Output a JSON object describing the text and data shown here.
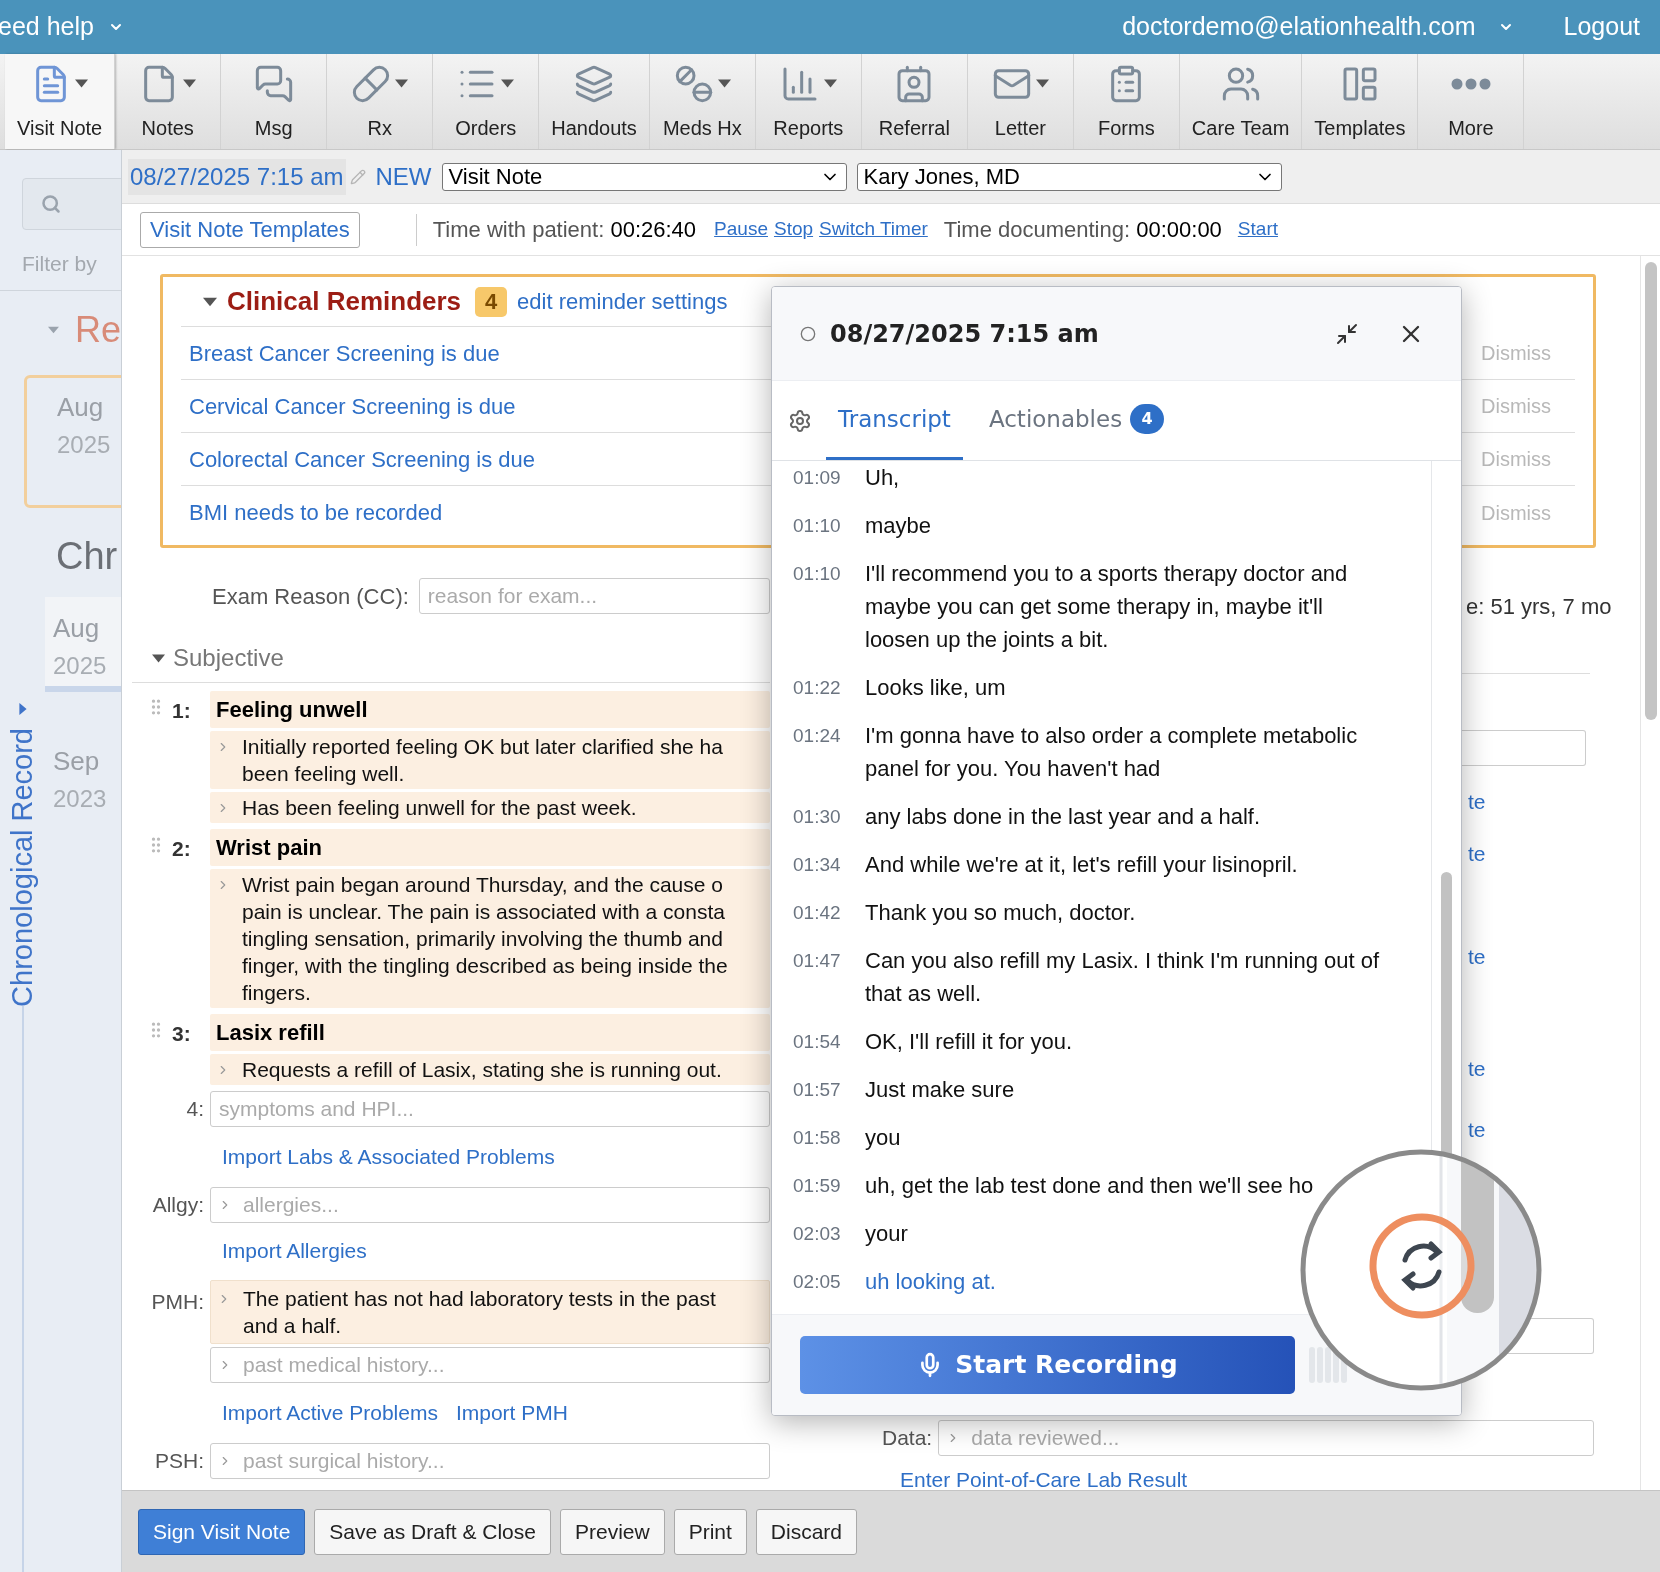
{
  "top_bar": {
    "help_menu": "eed help",
    "user_email": "doctordemo@elationhealth.com",
    "logout": "Logout"
  },
  "toolbar": [
    {
      "label": "Visit Note",
      "selected": true,
      "has_menu": true
    },
    {
      "label": "Notes",
      "selected": false,
      "has_menu": true
    },
    {
      "label": "Msg",
      "selected": false,
      "has_menu": false
    },
    {
      "label": "Rx",
      "selected": false,
      "has_menu": true
    },
    {
      "label": "Orders",
      "selected": false,
      "has_menu": true
    },
    {
      "label": "Handouts",
      "selected": false,
      "has_menu": false
    },
    {
      "label": "Meds Hx",
      "selected": false,
      "has_menu": true
    },
    {
      "label": "Reports",
      "selected": false,
      "has_menu": true
    },
    {
      "label": "Referral",
      "selected": false,
      "has_menu": false
    },
    {
      "label": "Letter",
      "selected": false,
      "has_menu": true
    },
    {
      "label": "Forms",
      "selected": false,
      "has_menu": false
    },
    {
      "label": "Care Team",
      "selected": false,
      "has_menu": false
    },
    {
      "label": "Templates",
      "selected": false,
      "has_menu": false
    },
    {
      "label": "More",
      "selected": false,
      "has_menu": false
    }
  ],
  "sidebar": {
    "filter_label": "Filter by",
    "section_title": "Re",
    "reminder_card": {
      "month": "Aug",
      "year": "2025"
    },
    "record_heading": "Chr",
    "entries": [
      {
        "month": "Aug",
        "year": "2025",
        "selected": true
      },
      {
        "month": "Sep",
        "year": "2023",
        "selected": false
      }
    ],
    "vertical_label": "Chronological Record"
  },
  "note_header": {
    "date": "08/27/2025 7:15 am",
    "status": "NEW",
    "note_type": "Visit Note",
    "provider": "Kary Jones, MD"
  },
  "timer": {
    "templates_button": "Visit Note Templates",
    "patient_label": "Time with patient:",
    "patient_time": "00:26:40",
    "patient_actions": [
      "Pause",
      "Stop",
      "Switch Timer"
    ],
    "doc_label": "Time documenting:",
    "doc_time": "00:00:00",
    "doc_action": "Start"
  },
  "reminders": {
    "title": "Clinical Reminders",
    "count": "4",
    "settings_link": "edit reminder settings",
    "expanded": true,
    "items": [
      {
        "text": "Breast Cancer Screening is due",
        "action": "Dismiss"
      },
      {
        "text": "Cervical Cancer Screening is due",
        "action": "Dismiss"
      },
      {
        "text": "Colorectal Cancer Screening is due",
        "action": "Dismiss"
      },
      {
        "text": "BMI needs to be recorded",
        "action": "Dismiss"
      }
    ]
  },
  "exam_reason": {
    "label": "Exam Reason (CC):",
    "placeholder": "reason for exam..."
  },
  "subjective": {
    "title": "Subjective",
    "expanded": true,
    "problems": [
      {
        "number": "1:",
        "title": "Feeling unwell",
        "notes": [
          {
            "lines": [
              "Initially reported feeling OK but later clarified she ha",
              "been feeling well."
            ]
          },
          {
            "lines": [
              "Has been feeling unwell for the past week."
            ]
          }
        ]
      },
      {
        "number": "2:",
        "title": "Wrist pain",
        "notes": [
          {
            "lines": [
              "Wrist pain began around Thursday, and the cause o",
              "pain is unclear. The pain is associated with a consta",
              "tingling sensation, primarily involving the thumb and",
              "finger, with the tingling described as being inside the",
              "fingers."
            ]
          }
        ]
      },
      {
        "number": "3:",
        "title": "Lasix refill",
        "notes": [
          {
            "lines": [
              "Requests a refill of Lasix, stating she is running out."
            ]
          }
        ]
      }
    ],
    "new_problem": {
      "number": "4:",
      "placeholder": "symptoms and HPI..."
    },
    "import_link": "Import Labs & Associated Problems"
  },
  "allergies": {
    "label": "Allgy:",
    "placeholder": "allergies...",
    "link": "Import Allergies"
  },
  "pmh": {
    "label": "PMH:",
    "entries": [
      {
        "lines": [
          "The patient has not had laboratory tests in the past",
          "and a half."
        ]
      }
    ],
    "placeholder": "past medical history...",
    "links": [
      "Import Active Problems",
      "Import PMH"
    ]
  },
  "psh": {
    "label": "PSH:",
    "placeholder": "past surgical history..."
  },
  "right_column": {
    "age_fragment": "e: 51 yrs, 7 mo",
    "link_fragments": [
      "te",
      "te",
      "te",
      "te",
      "te"
    ],
    "data_label": "Data:",
    "data_placeholder": "data reviewed...",
    "poc_link": "Enter Point-of-Care Lab Result"
  },
  "footer_buttons": [
    {
      "label": "Sign Visit Note",
      "kind": "primary"
    },
    {
      "label": "Save as Draft & Close",
      "kind": "secondary"
    },
    {
      "label": "Preview",
      "kind": "secondary"
    },
    {
      "label": "Print",
      "kind": "secondary"
    },
    {
      "label": "Discard",
      "kind": "secondary"
    }
  ],
  "transcript_panel": {
    "date": "08/27/2025 7:15 am",
    "tabs": [
      {
        "label": "Transcript",
        "selected": true
      },
      {
        "label": "Actionables",
        "selected": false,
        "badge": "4"
      }
    ],
    "entries": [
      {
        "time": "01:09",
        "text": "Uh,",
        "highlighted": false
      },
      {
        "time": "01:10",
        "text": "maybe",
        "highlighted": false
      },
      {
        "time": "01:10",
        "text": "I'll recommend you to a sports therapy doctor and maybe you can get some therapy in, maybe it'll loosen up the joints a bit.",
        "highlighted": false
      },
      {
        "time": "01:22",
        "text": "Looks like, um",
        "highlighted": false
      },
      {
        "time": "01:24",
        "text": "I'm gonna have to also order a complete metabolic panel for you. You haven't had",
        "highlighted": false
      },
      {
        "time": "01:30",
        "text": "any labs done in the last year and a half.",
        "highlighted": false
      },
      {
        "time": "01:34",
        "text": "And while we're at it, let's refill your lisinopril.",
        "highlighted": false
      },
      {
        "time": "01:42",
        "text": "Thank you so much, doctor.",
        "highlighted": false
      },
      {
        "time": "01:47",
        "text": "Can you also refill my Lasix. I think I'm running out of that as well.",
        "highlighted": false
      },
      {
        "time": "01:54",
        "text": "OK, I'll refill it for you.",
        "highlighted": false
      },
      {
        "time": "01:57",
        "text": "Just make sure",
        "highlighted": false
      },
      {
        "time": "01:58",
        "text": "you",
        "highlighted": false
      },
      {
        "time": "01:59",
        "text": "uh, get the lab test done and then we'll see ho",
        "highlighted": false
      },
      {
        "time": "02:03",
        "text": "your",
        "highlighted": false
      },
      {
        "time": "02:05",
        "text": "uh looking at.",
        "highlighted": true
      }
    ],
    "record_button": "Start Recording"
  }
}
